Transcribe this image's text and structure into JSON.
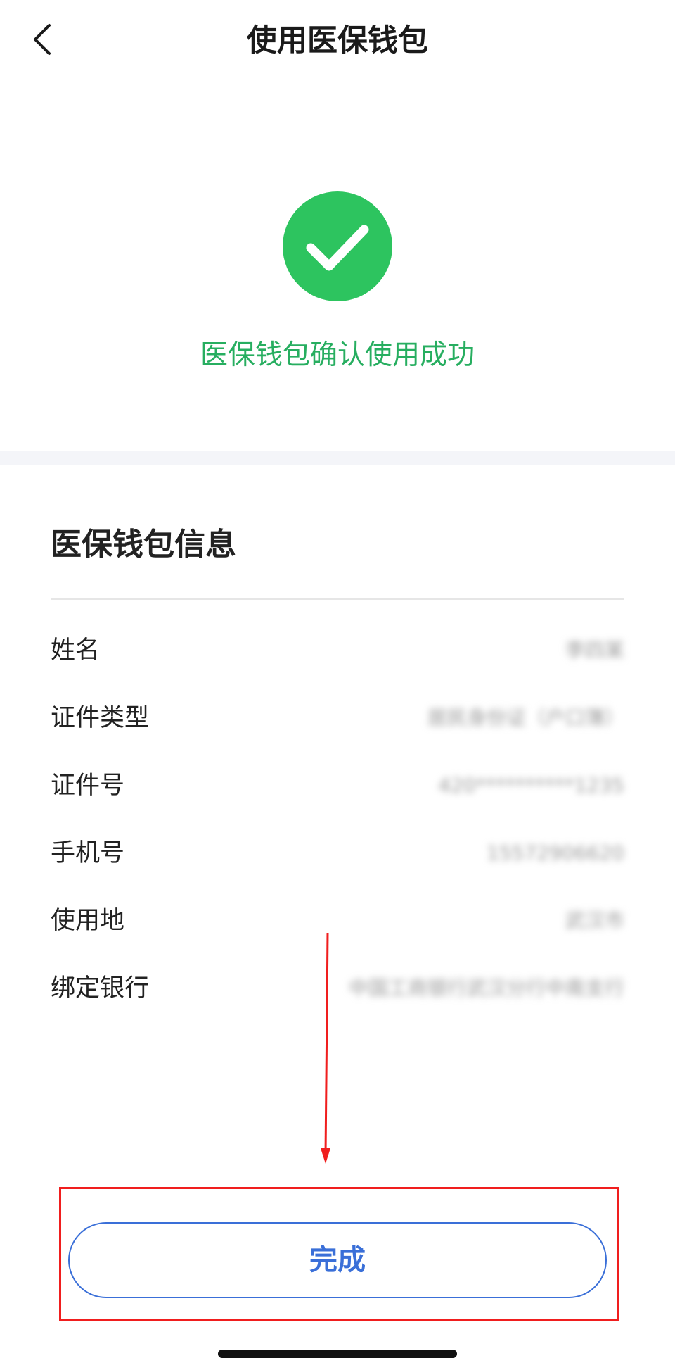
{
  "nav": {
    "title": "使用医保钱包"
  },
  "result": {
    "message": "医保钱包确认使用成功",
    "icon": "check-circle-icon",
    "color": "#27ae60"
  },
  "info": {
    "title": "医保钱包信息",
    "rows": [
      {
        "label": "姓名",
        "value": "李四某"
      },
      {
        "label": "证件类型",
        "value": "居民身份证（户口簿）"
      },
      {
        "label": "证件号",
        "value": "420**********1235"
      },
      {
        "label": "手机号",
        "value": "15572906620"
      },
      {
        "label": "使用地",
        "value": "武汉市"
      },
      {
        "label": "绑定银行",
        "value": "中国工商银行武汉分行中南支行"
      }
    ]
  },
  "footer": {
    "done_label": "完成",
    "accent": "#3a6fd8"
  },
  "annotation": {
    "color": "#f01e1e"
  }
}
